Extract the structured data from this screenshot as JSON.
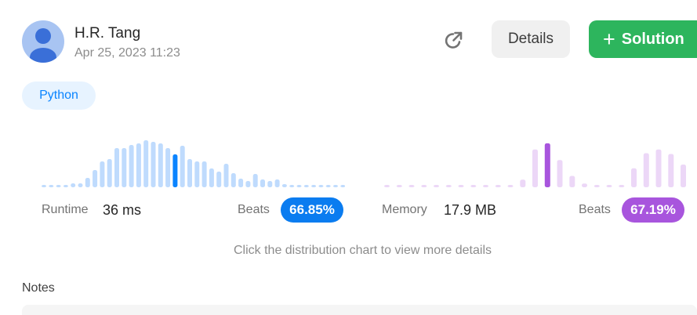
{
  "user": {
    "name": "H.R. Tang",
    "date": "Apr 25, 2023 11:23"
  },
  "icons": {
    "avatar": "user-avatar-icon",
    "share": "share-icon",
    "plus": "plus-icon"
  },
  "buttons": {
    "details": "Details",
    "solution": "Solution"
  },
  "language": "Python",
  "colors": {
    "runtime_bar": "#bfdbfd",
    "runtime_highlight": "#0a84ff",
    "memory_bar": "#ecd7f7",
    "memory_highlight": "#a855dd",
    "solution_button": "#2db55d",
    "runtime_badge": "#0a7cf0",
    "memory_badge": "#a855dd"
  },
  "runtime": {
    "label": "Runtime",
    "value": "36 ms",
    "beats_label": "Beats",
    "beats": "66.85%"
  },
  "memory": {
    "label": "Memory",
    "value": "17.9 MB",
    "beats_label": "Beats",
    "beats": "67.19%"
  },
  "hint": "Click the distribution chart to view more details",
  "notes_label": "Notes",
  "chart_data": [
    {
      "type": "bar",
      "name": "runtime-distribution",
      "values": [
        3,
        3,
        3,
        3,
        5,
        5,
        12,
        22,
        33,
        36,
        50,
        50,
        54,
        56,
        60,
        58,
        56,
        50,
        42,
        53,
        36,
        33,
        33,
        24,
        20,
        30,
        18,
        11,
        8,
        17,
        10,
        8,
        10,
        4,
        3,
        3,
        3,
        3,
        3,
        3,
        3,
        3
      ],
      "highlight_index": 18,
      "ylim": [
        0,
        60
      ]
    },
    {
      "type": "bar",
      "name": "memory-distribution",
      "values": [
        3,
        3,
        3,
        3,
        3,
        3,
        3,
        3,
        3,
        3,
        3,
        10,
        50,
        58,
        36,
        15,
        5,
        3,
        3,
        3,
        25,
        45,
        50,
        44,
        30
      ],
      "highlight_index": 13,
      "ylim": [
        0,
        60
      ]
    }
  ]
}
